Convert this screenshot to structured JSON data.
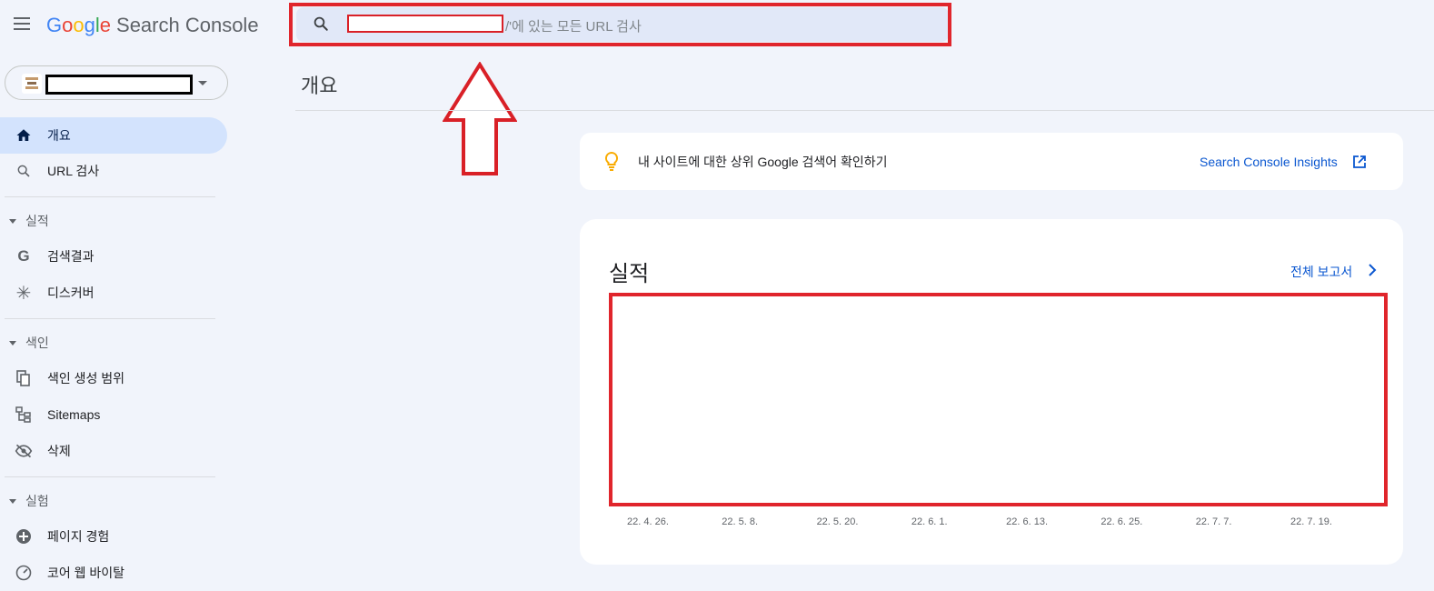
{
  "header": {
    "logo_word": [
      "G",
      "o",
      "o",
      "g",
      "l",
      "e"
    ],
    "product": "Search Console",
    "search_placeholder": "/'에 있는 모든 URL 검사"
  },
  "sidebar": {
    "items": [
      {
        "label": "개요",
        "icon": "home-icon",
        "active": true
      },
      {
        "label": "URL 검사",
        "icon": "search-icon"
      }
    ],
    "sections": [
      {
        "label": "실적",
        "items": [
          {
            "label": "검색결과",
            "icon": "google-g-icon"
          },
          {
            "label": "디스커버",
            "icon": "asterisk-icon"
          }
        ]
      },
      {
        "label": "색인",
        "items": [
          {
            "label": "색인 생성 범위",
            "icon": "copy-pages-icon"
          },
          {
            "label": "Sitemaps",
            "icon": "sitemap-icon"
          },
          {
            "label": "삭제",
            "icon": "eye-off-icon"
          }
        ]
      },
      {
        "label": "실험",
        "items": [
          {
            "label": "페이지 경험",
            "icon": "plus-circle-icon"
          },
          {
            "label": "코어 웹 바이탈",
            "icon": "gauge-icon"
          }
        ]
      }
    ]
  },
  "main": {
    "page_title": "개요",
    "insights": {
      "text": "내 사이트에 대한 상위 Google 검색어 확인하기",
      "link": "Search Console Insights"
    },
    "performance": {
      "title": "실적",
      "full_report": "전체 보고서"
    }
  },
  "colors": {
    "accent": "#0b57d0",
    "highlight": "#e0252c",
    "active_bg": "#d3e3fd",
    "page_bg": "#f1f4fb"
  },
  "chart_data": {
    "type": "line",
    "x": [
      "22. 4. 26.",
      "22. 5. 8.",
      "22. 5. 20.",
      "22. 6. 1.",
      "22. 6. 13.",
      "22. 6. 25.",
      "22. 7. 7.",
      "22. 7. 19."
    ],
    "series": []
  }
}
